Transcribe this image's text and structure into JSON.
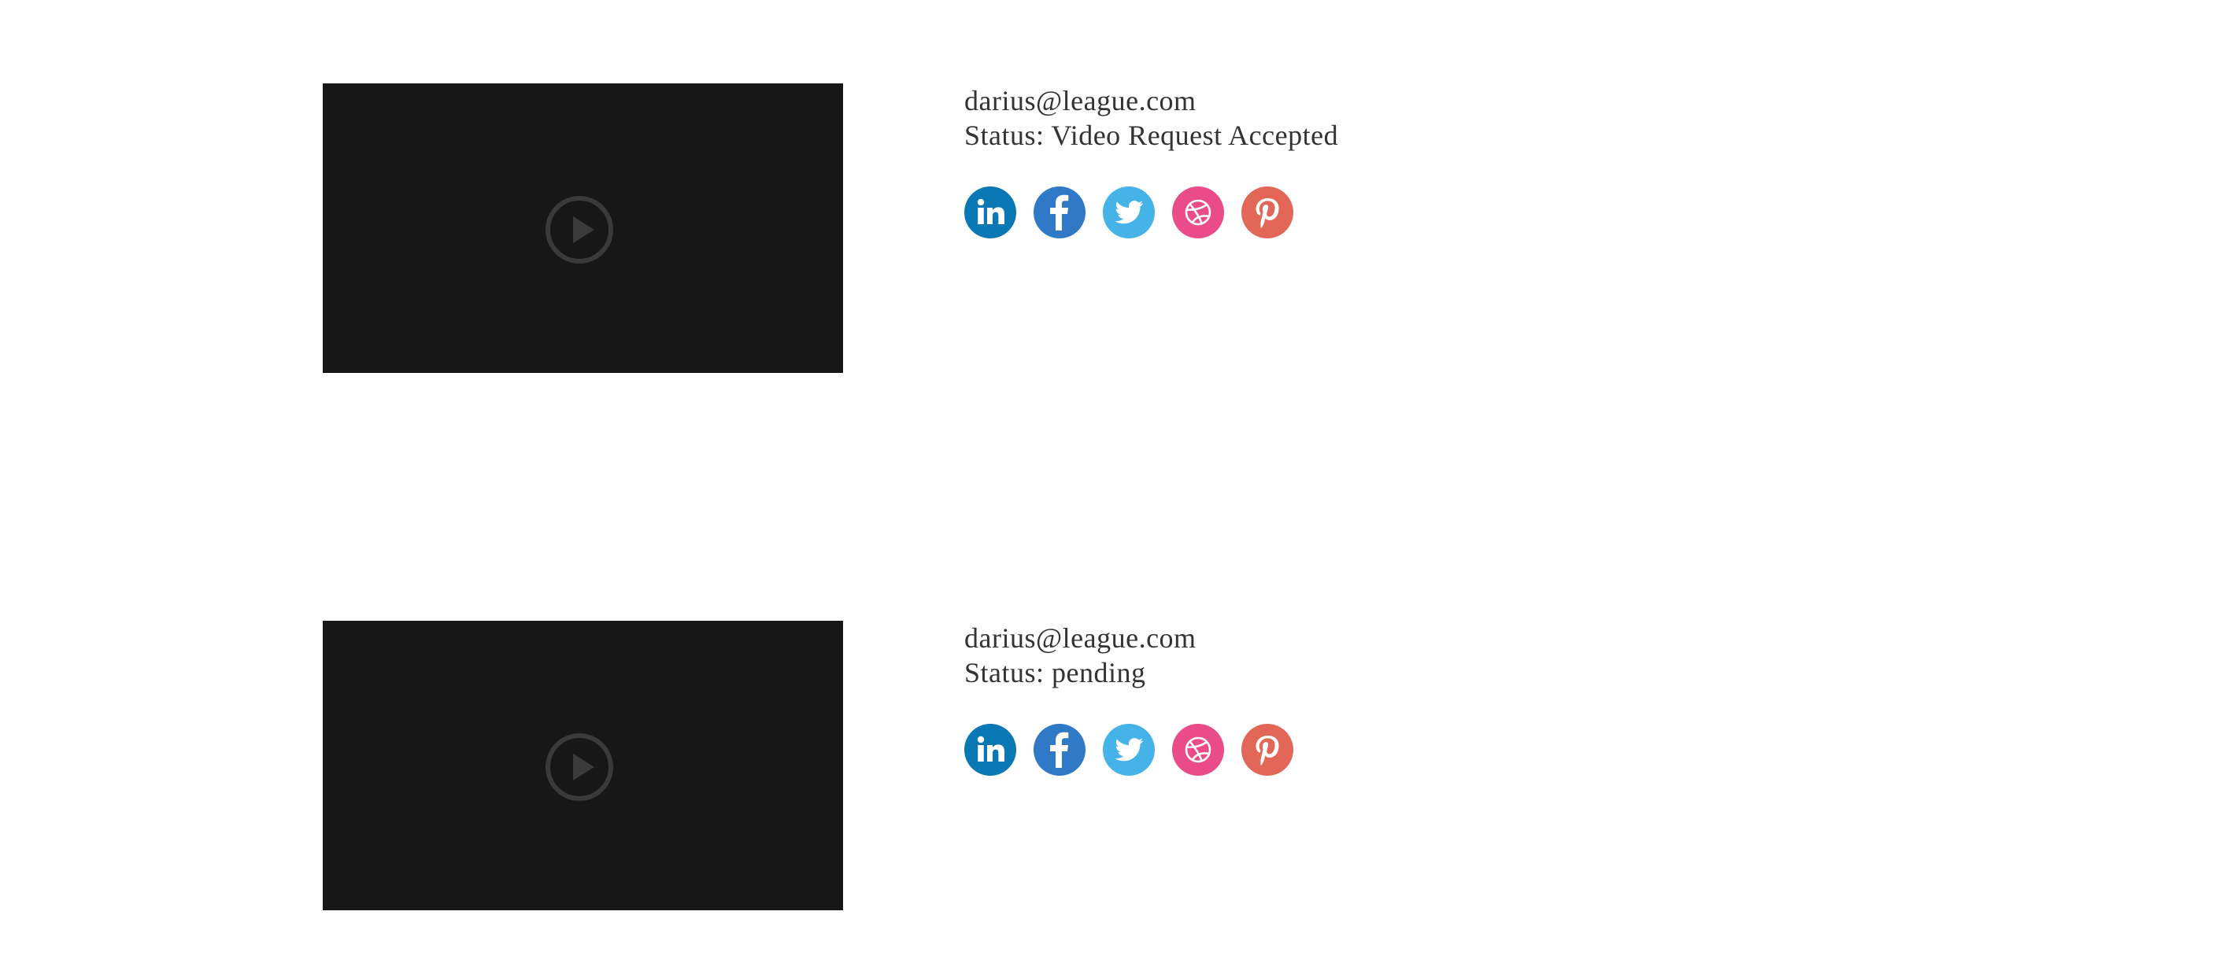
{
  "entries": [
    {
      "email": "darius@league.com",
      "status": "Status: Video Request Accepted"
    },
    {
      "email": "darius@league.com",
      "status": "Status: pending"
    }
  ],
  "social_icons": [
    {
      "name": "linkedin-icon",
      "color": "#0b78b6"
    },
    {
      "name": "facebook-icon",
      "color": "#2f79c7"
    },
    {
      "name": "twitter-icon",
      "color": "#45b3e8"
    },
    {
      "name": "dribbble-icon",
      "color": "#ea4c89"
    },
    {
      "name": "pinterest-icon",
      "color": "#e26758"
    }
  ],
  "colors": {
    "video_bg": "#171717",
    "play_icon": "#3a3a3a",
    "text": "#333333"
  }
}
